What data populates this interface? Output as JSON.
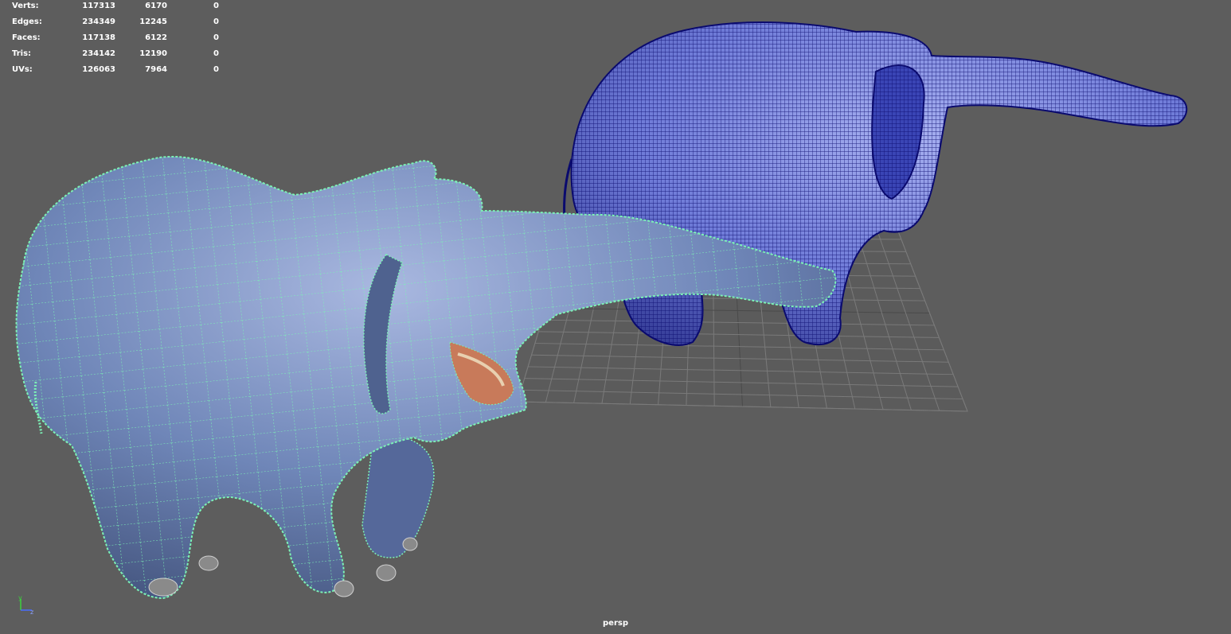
{
  "hud": {
    "rows": [
      {
        "label": "Verts:",
        "v1": "117313",
        "v2": "6170",
        "v3": "0"
      },
      {
        "label": "Edges:",
        "v1": "234349",
        "v2": "12245",
        "v3": "0"
      },
      {
        "label": "Faces:",
        "v1": "117138",
        "v2": "6122",
        "v3": "0"
      },
      {
        "label": "Tris:",
        "v1": "234142",
        "v2": "12190",
        "v3": "0"
      },
      {
        "label": "UVs:",
        "v1": "126063",
        "v2": "7964",
        "v3": "0"
      }
    ]
  },
  "viewport": {
    "camera": "persp",
    "axis": {
      "y": "y",
      "z": "z"
    }
  },
  "colors": {
    "background": "#5d5d5d",
    "grid": "#7a7a7a",
    "smooth_mesh": "#6f7bd8",
    "smooth_wire": "#0a0a6e",
    "low_mesh": "#6f86b8",
    "low_wire": "#7cf2b6"
  }
}
